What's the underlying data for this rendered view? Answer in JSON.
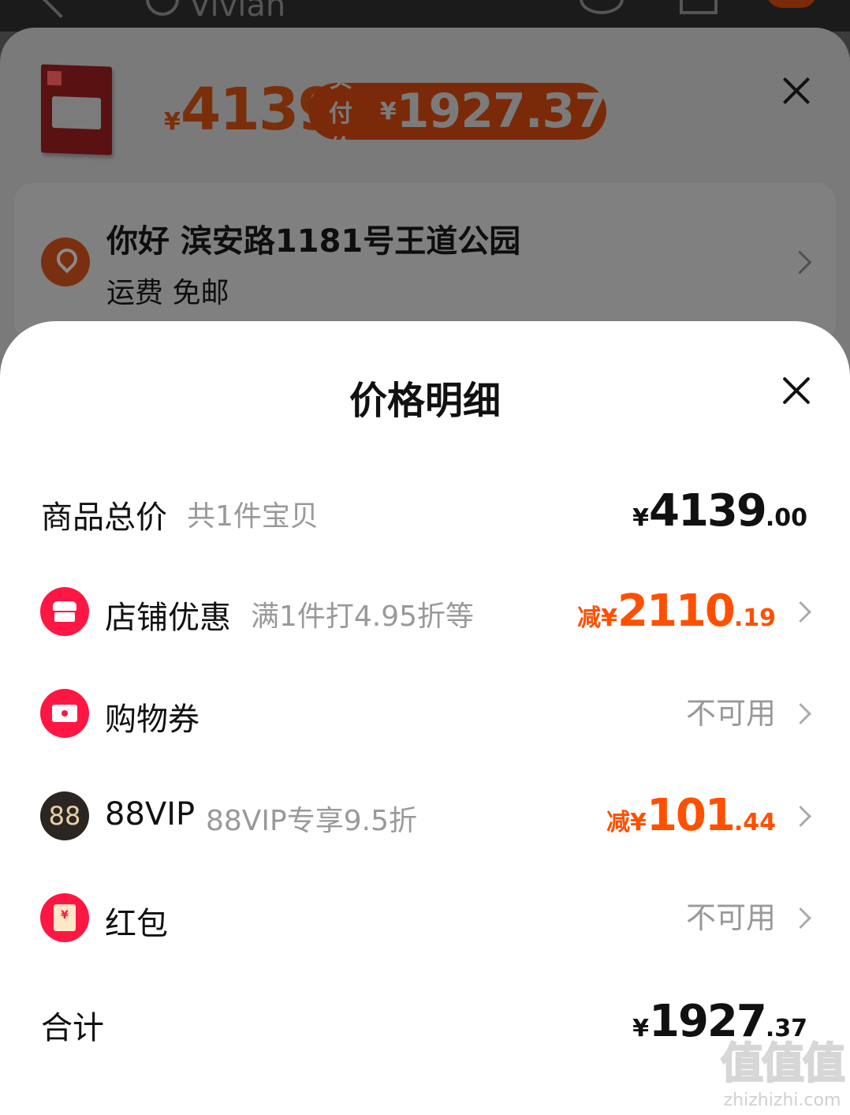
{
  "header": {
    "search_text": "Vivian"
  },
  "product": {
    "currency": "¥",
    "price": "4139",
    "actual_label": "实付价",
    "actual_price": "1927.37"
  },
  "address": {
    "title": "你好 滨安路1181号王道公园",
    "shipping": "运费 免邮"
  },
  "sheet": {
    "title": "价格明细",
    "rows": [
      {
        "label": "商品总价",
        "desc": "共1件宝贝",
        "prefix": "¥",
        "int": "4139",
        "dec": ".00"
      },
      {
        "label": "店铺优惠",
        "desc": "满1件打4.95折等",
        "prefix": "减¥",
        "int": "2110",
        "dec": ".19",
        "icon": "shop-icon"
      },
      {
        "label": "购物券",
        "status": "不可用",
        "icon": "coupon-icon"
      },
      {
        "label": "88VIP",
        "desc": "88VIP专享9.5折",
        "prefix": "减¥",
        "int": "101",
        "dec": ".44",
        "icon": "88vip-icon",
        "icon_text": "88"
      },
      {
        "label": "红包",
        "status": "不可用",
        "icon": "red-packet-icon",
        "icon_text": "¥"
      }
    ],
    "total": {
      "label": "合计",
      "prefix": "¥",
      "int": "1927",
      "dec": ".37"
    }
  },
  "watermark": {
    "logo": "值值值",
    "site": "zhizhizhi.com"
  },
  "colors": {
    "accent": "#ff5000",
    "icon_red": "#ff1744",
    "vip_dark": "#2b2622"
  }
}
